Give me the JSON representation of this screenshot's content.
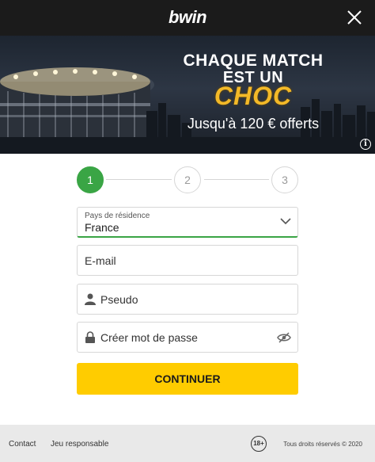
{
  "header": {
    "logo": "bwin",
    "close_icon": "close-icon"
  },
  "banner": {
    "line1": "CHAQUE MATCH",
    "line2": "EST UN",
    "line3": "CHOC",
    "line4": "Jusqu'à 120 € offerts",
    "info": "i"
  },
  "stepper": {
    "steps": [
      "1",
      "2",
      "3"
    ],
    "active_step": 1
  },
  "form": {
    "country_label": "Pays de résidence",
    "country_value": "France",
    "email_placeholder": "E-mail",
    "pseudo_placeholder": "Pseudo",
    "password_placeholder": "Créer mot de passe",
    "continue_label": "CONTINUER"
  },
  "footer": {
    "contact": "Contact",
    "responsible": "Jeu responsable",
    "age": "18+",
    "copyright": "Tous droits réservés © 2020"
  },
  "colors": {
    "accent_green": "#3aa545",
    "button_yellow": "#ffcc00",
    "choc_gold": "#f3b928",
    "header_bg": "#1b1b1b"
  }
}
